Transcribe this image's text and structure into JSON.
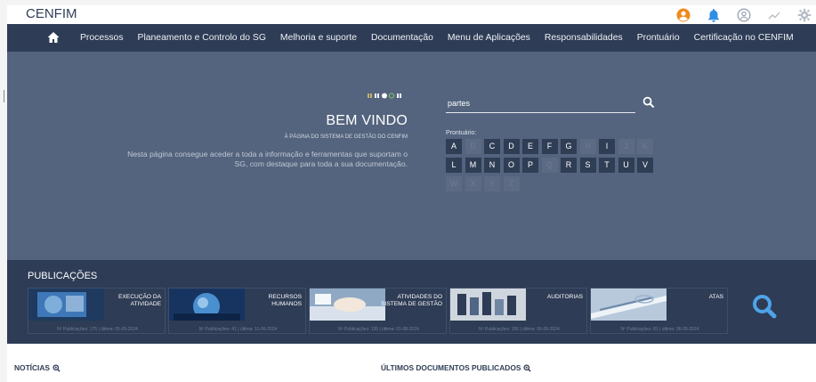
{
  "brand": "CENFIM",
  "top_icons": [
    "user-icon",
    "bell-icon",
    "user-outline-icon",
    "chart-line-icon",
    "gear-icon"
  ],
  "nav": {
    "items": [
      "Processos",
      "Planeamento e Controlo do SG",
      "Melhoria e suporte",
      "Documentação",
      "Menu de Aplicações",
      "Responsabilidades",
      "Prontuário",
      "Certificação no CENFIM"
    ]
  },
  "hero": {
    "title": "BEM VINDO",
    "subtitle": "À PÁGINA DO SISTEMA DE GESTÃO DO CENFIM",
    "description": "Nesta página consegue aceder a toda a informação e ferramentas que suportam o SG, com destaque para toda a sua documentação.",
    "search_value": "partes",
    "prontuario_label": "Prontuário:",
    "letters": [
      {
        "l": "A",
        "active": true
      },
      {
        "l": "B",
        "active": false
      },
      {
        "l": "C",
        "active": true
      },
      {
        "l": "D",
        "active": true
      },
      {
        "l": "E",
        "active": true
      },
      {
        "l": "F",
        "active": true
      },
      {
        "l": "G",
        "active": true
      },
      {
        "l": "H",
        "active": false
      },
      {
        "l": "I",
        "active": true
      },
      {
        "l": "J",
        "active": false
      },
      {
        "l": "K",
        "active": false
      },
      {
        "l": "L",
        "active": true
      },
      {
        "l": "M",
        "active": true
      },
      {
        "l": "N",
        "active": true
      },
      {
        "l": "O",
        "active": true
      },
      {
        "l": "P",
        "active": true
      },
      {
        "l": "Q",
        "active": false
      },
      {
        "l": "R",
        "active": true
      },
      {
        "l": "S",
        "active": true
      },
      {
        "l": "T",
        "active": true
      },
      {
        "l": "U",
        "active": true
      },
      {
        "l": "V",
        "active": true
      },
      {
        "l": "W",
        "active": false
      },
      {
        "l": "X",
        "active": false
      },
      {
        "l": "Y",
        "active": false
      },
      {
        "l": "Z",
        "active": false
      }
    ]
  },
  "publicacoes": {
    "title": "PUBLICAÇÕES",
    "cards": [
      {
        "label": "EXECUÇÃO DA ATIVIDADE",
        "count": "Nº Publicações: 175 | última: 05-09-2024"
      },
      {
        "label": "RECURSOS HUMANOS",
        "count": "Nº Publicações: 41 | última: 11-06-2024"
      },
      {
        "label": "ATIVIDADES DO SISTEMA DE GESTÃO",
        "count": "Nº Publicações: 135 | última: 01-08-2024"
      },
      {
        "label": "AUDITORIAS",
        "count": "Nº Publicações: 156 | última: 06-09-2024"
      },
      {
        "label": "ATAS",
        "count": "Nº Publicações: 81 | última: 06-09-2024"
      }
    ]
  },
  "bottom": {
    "noticias": "NOTÍCIAS",
    "ultimos": "ÚLTIMOS DOCUMENTOS PUBLICADOS"
  },
  "colors": {
    "navy": "#2e3c55",
    "hero": "#54647e",
    "accent_orange": "#f08a1c",
    "accent_blue": "#2f8de4",
    "pubs_search": "#4da3e8"
  }
}
